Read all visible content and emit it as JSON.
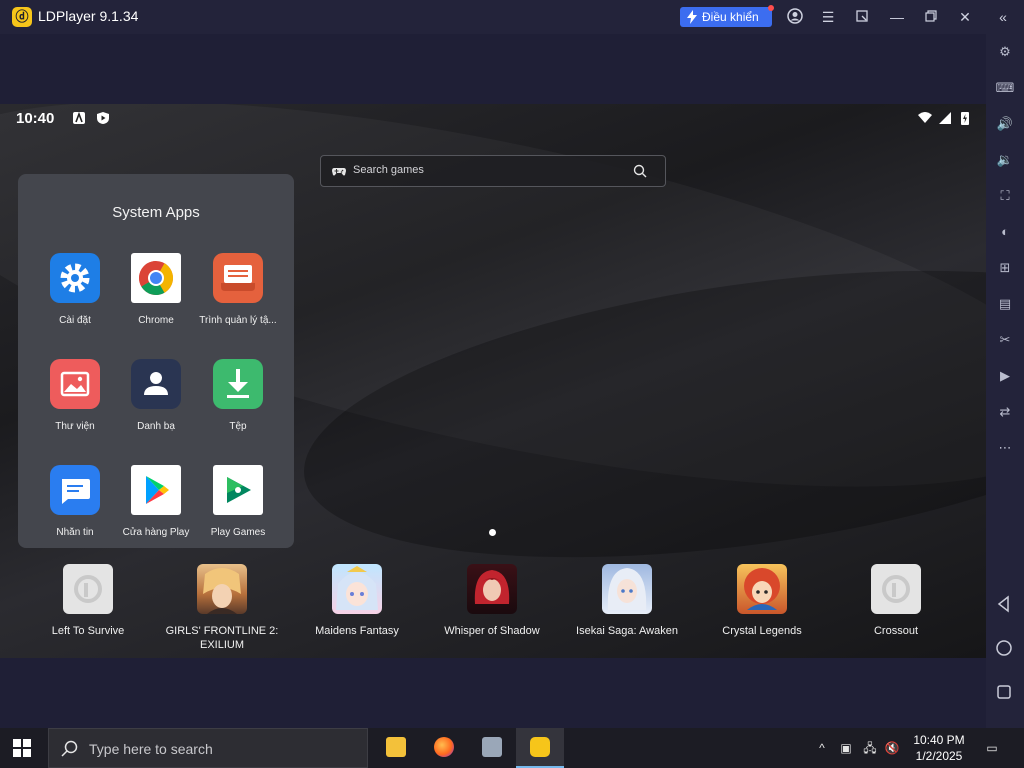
{
  "window": {
    "title": "LDPlayer 9.1.34",
    "control_button_label": "Điều khiển",
    "accent_color": "#3c6df0"
  },
  "statusbar": {
    "time": "10:40"
  },
  "search": {
    "placeholder": "Search games"
  },
  "folder": {
    "title": "System Apps",
    "apps": [
      {
        "label": "Cài đặt",
        "icon": "settings-icon"
      },
      {
        "label": "Chrome",
        "icon": "chrome-icon"
      },
      {
        "label": "Trình quản lý tậ...",
        "icon": "file-manager-icon"
      },
      {
        "label": "Thư viện",
        "icon": "gallery-icon"
      },
      {
        "label": "Danh bạ",
        "icon": "contacts-icon"
      },
      {
        "label": "Tệp",
        "icon": "download-icon"
      },
      {
        "label": "Nhắn tin",
        "icon": "messages-icon"
      },
      {
        "label": "Cửa hàng Play",
        "icon": "play-store-icon"
      },
      {
        "label": "Play Games",
        "icon": "play-games-icon"
      }
    ]
  },
  "dock": {
    "apps": [
      {
        "label": "Left To Survive",
        "icon": "placeholder-app-icon"
      },
      {
        "label": "GIRLS' FRONTLINE 2: EXILIUM",
        "icon": "game-icon"
      },
      {
        "label": "Maidens Fantasy",
        "icon": "game-icon"
      },
      {
        "label": "Whisper of Shadow",
        "icon": "game-icon"
      },
      {
        "label": "Isekai Saga: Awaken",
        "icon": "game-icon"
      },
      {
        "label": "Crystal Legends",
        "icon": "game-icon"
      },
      {
        "label": "Crossout",
        "icon": "placeholder-app-icon"
      }
    ]
  },
  "taskbar": {
    "search_placeholder": "Type here to search",
    "clock_time": "10:40 PM",
    "clock_date": "1/2/2025"
  }
}
